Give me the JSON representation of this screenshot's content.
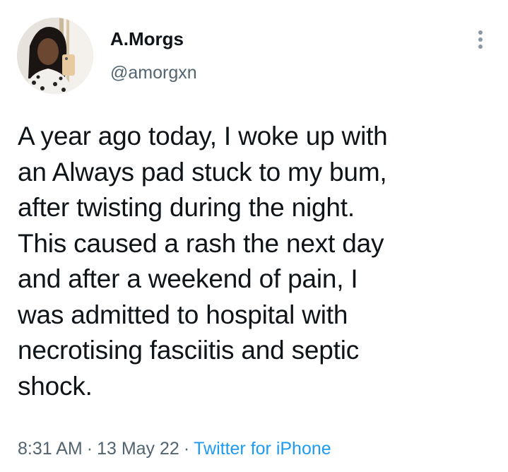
{
  "author": {
    "display_name": "A.Morgs",
    "handle": "@amorgxn",
    "avatar": "profile-photo"
  },
  "menu": {
    "icon": "more-vertical-icon"
  },
  "tweet": {
    "text": "A year ago today, I woke up with\nan Always pad stuck to my bum,\nafter twisting during the night.\nThis caused a rash the next day\nand after a weekend of pain, I\nwas admitted to hospital with\nnecrotising fasciitis and septic\nshock.",
    "time": "8:31 AM",
    "date": "13 May 22",
    "separator": "·",
    "source": "Twitter for iPhone"
  },
  "colors": {
    "text": "#0f1419",
    "secondary": "#536471",
    "link": "#1d9bf0"
  }
}
